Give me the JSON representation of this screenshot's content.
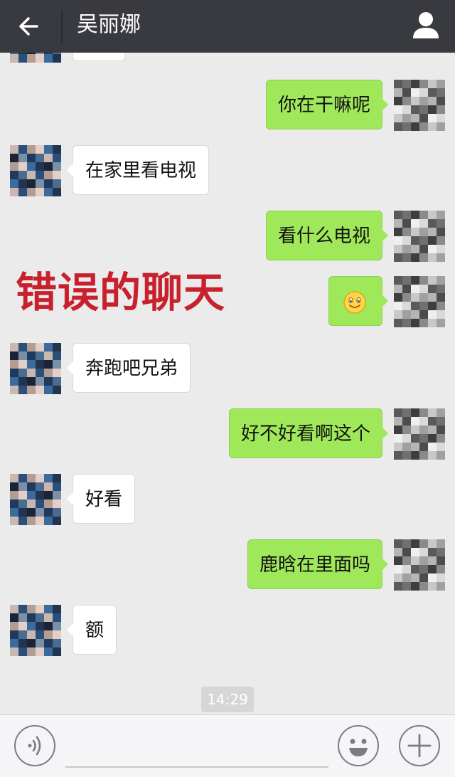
{
  "header": {
    "title": "吴丽娜",
    "back_icon": "arrow-left-icon",
    "profile_icon": "user-icon"
  },
  "watermark": "错误的聊天",
  "messages": [
    {
      "from": "them",
      "text": ""
    },
    {
      "from": "me",
      "text": "你在干嘛呢"
    },
    {
      "from": "them",
      "text": "在家里看电视"
    },
    {
      "from": "me",
      "text": "看什么电视"
    },
    {
      "from": "me",
      "text": "",
      "emoji": "smile-emoji"
    },
    {
      "from": "them",
      "text": "奔跑吧兄弟"
    },
    {
      "from": "me",
      "text": "好不好看啊这个"
    },
    {
      "from": "them",
      "text": "好看"
    },
    {
      "from": "me",
      "text": "鹿晗在里面吗"
    },
    {
      "from": "them",
      "text": "额"
    }
  ],
  "timestamp": "14:29",
  "input_bar": {
    "voice_icon": "voice-icon",
    "input_value": "",
    "emoji_icon": "emoji-icon",
    "plus_icon": "plus-icon"
  },
  "colors": {
    "header_bg": "#393a3f",
    "chat_bg": "#ebebeb",
    "outgoing_bubble": "#9fe85a",
    "incoming_bubble": "#ffffff",
    "watermark_red": "#c8202c"
  }
}
